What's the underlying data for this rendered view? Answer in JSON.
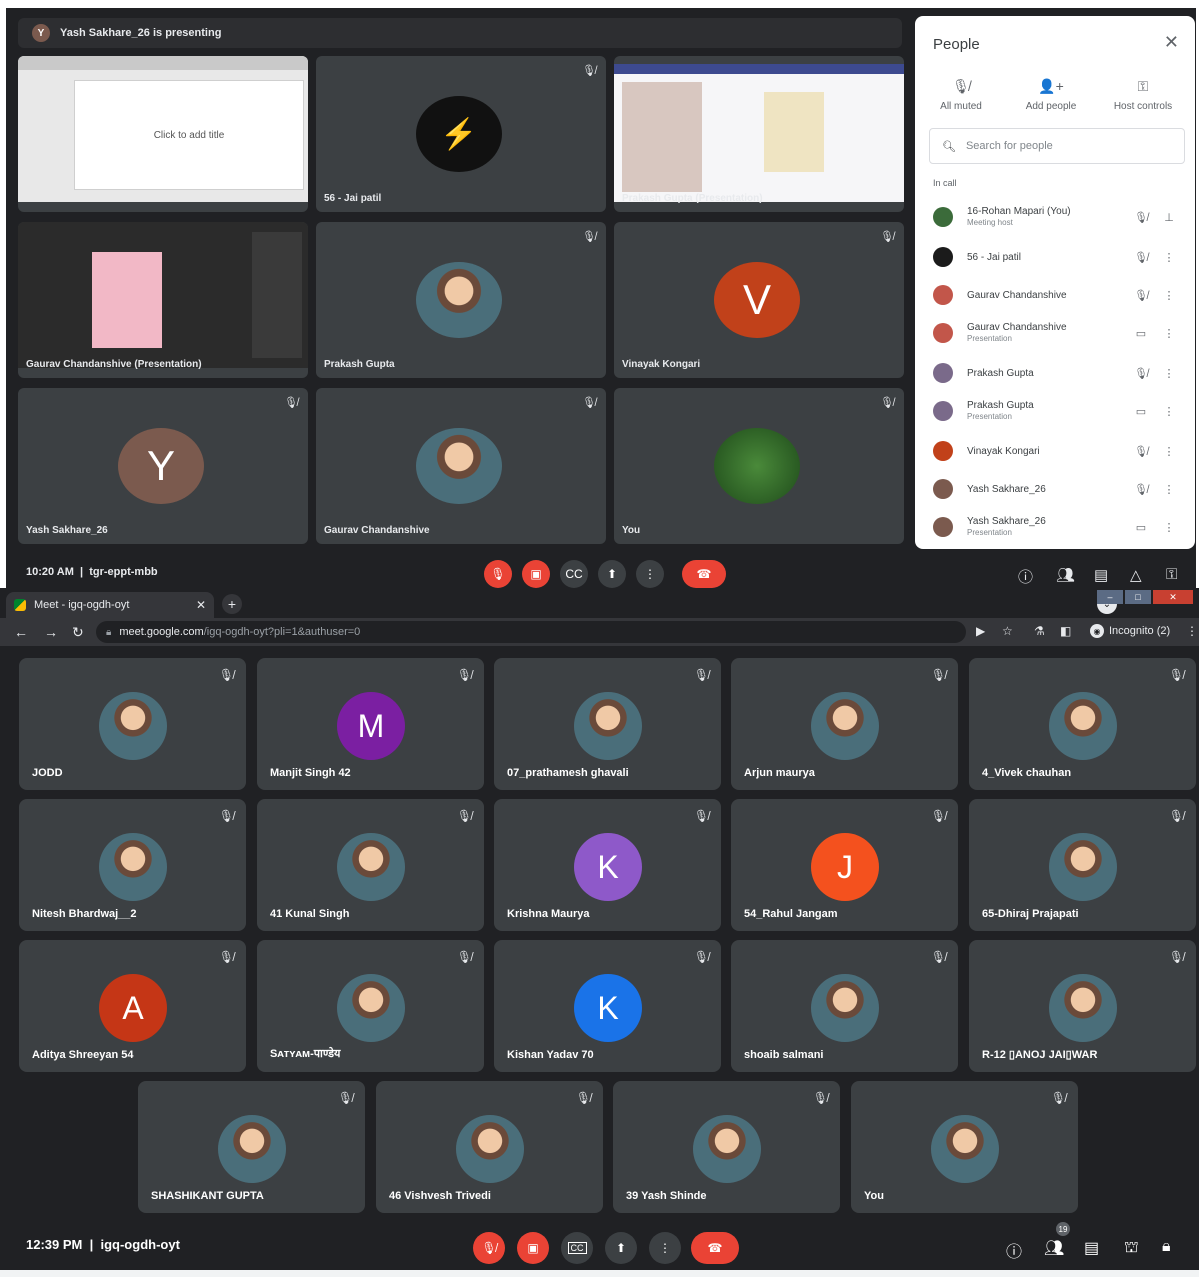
{
  "top_screen": {
    "presenting_text": "Yash Sakhare_26 is presenting",
    "presenter_initial": "Y",
    "tiles": [
      {
        "name": "",
        "kind": "slide",
        "slide_text": "Click to add title"
      },
      {
        "name": "56 - Jai patil",
        "kind": "logo"
      },
      {
        "name": "Prakash Gupta (Presentation)",
        "kind": "screen"
      },
      {
        "name": "Gaurav Chandanshive (Presentation)",
        "kind": "screen2"
      },
      {
        "name": "Prakash Gupta",
        "kind": "photo"
      },
      {
        "name": "Vinayak Kongari",
        "kind": "initial",
        "initial": "V",
        "color": "#c1411a"
      },
      {
        "name": "Yash Sakhare_26",
        "kind": "initial",
        "initial": "Y",
        "color": "#7b5a4e"
      },
      {
        "name": "Gaurav Chandanshive",
        "kind": "photo"
      },
      {
        "name": "You",
        "kind": "photo"
      }
    ],
    "people_panel": {
      "title": "People",
      "actions": [
        {
          "label": "All muted",
          "icon": "mic-off-icon"
        },
        {
          "label": "Add people",
          "icon": "add-person-icon"
        },
        {
          "label": "Host controls",
          "icon": "host-controls-icon"
        }
      ],
      "search_placeholder": "Search for people",
      "section_label": "In call",
      "participants": [
        {
          "name": "16-Rohan Mapari (You)",
          "sub": "Meeting host",
          "color": "#3b6b3a"
        },
        {
          "name": "56 - Jai patil",
          "sub": "",
          "color": "#1b1b1b"
        },
        {
          "name": "Gaurav Chandanshive",
          "sub": "",
          "color": "#c2564a"
        },
        {
          "name": "Gaurav Chandanshive",
          "sub": "Presentation",
          "color": "#c2564a"
        },
        {
          "name": "Prakash Gupta",
          "sub": "",
          "color": "#7a6a8a"
        },
        {
          "name": "Prakash Gupta",
          "sub": "Presentation",
          "color": "#7a6a8a"
        },
        {
          "name": "Vinayak Kongari",
          "sub": "",
          "color": "#c1411a"
        },
        {
          "name": "Yash Sakhare_26",
          "sub": "",
          "color": "#7b5a4e"
        },
        {
          "name": "Yash Sakhare_26",
          "sub": "Presentation",
          "color": "#7b5a4e"
        }
      ]
    },
    "time": "10:20 AM",
    "meeting_code": "tgr-eppt-mbb"
  },
  "browser": {
    "tab_title": "Meet - igq-ogdh-oyt",
    "url_host": "meet.google.com",
    "url_path": "/igq-ogdh-oyt?pli=1&authuser=0",
    "incognito_label": "Incognito (2)"
  },
  "meet": {
    "tiles": [
      {
        "name": "JODD",
        "initial": "",
        "color": ""
      },
      {
        "name": "Manjit Singh 42",
        "initial": "M",
        "color": "#7b1fa2"
      },
      {
        "name": "07_prathamesh ghavali",
        "initial": "",
        "color": ""
      },
      {
        "name": "Arjun maurya",
        "initial": "",
        "color": ""
      },
      {
        "name": "4_Vivek chauhan",
        "initial": "",
        "color": ""
      },
      {
        "name": "Nitesh Bhardwaj__2",
        "initial": "",
        "color": ""
      },
      {
        "name": "41 Kunal Singh",
        "initial": "",
        "color": ""
      },
      {
        "name": "Krishna Maurya",
        "initial": "K",
        "color": "#8e59c9"
      },
      {
        "name": "54_Rahul Jangam",
        "initial": "J",
        "color": "#f4511e"
      },
      {
        "name": "65-Dhiraj Prajapati",
        "initial": "",
        "color": ""
      },
      {
        "name": "Aditya Shreeyan 54",
        "initial": "A",
        "color": "#c53616"
      },
      {
        "name": "Sᴀᴛʏᴀᴍ-पाण्डेय",
        "initial": "",
        "color": ""
      },
      {
        "name": "Kishan Yadav 70",
        "initial": "K",
        "color": "#1a73e8"
      },
      {
        "name": "shoaib salmani",
        "initial": "",
        "color": ""
      },
      {
        "name": "R-12 ▯ANOJ JAI▯WAR",
        "initial": "",
        "color": ""
      },
      {
        "name": "SHASHIKANT GUPTA",
        "initial": "",
        "color": ""
      },
      {
        "name": "46 Vishvesh Trivedi",
        "initial": "",
        "color": ""
      },
      {
        "name": "39 Yash Shinde",
        "initial": "",
        "color": ""
      },
      {
        "name": "You",
        "initial": "",
        "color": ""
      }
    ],
    "time": "12:39 PM",
    "separator": "|",
    "meeting_code": "igq-ogdh-oyt",
    "participant_count": "19"
  }
}
